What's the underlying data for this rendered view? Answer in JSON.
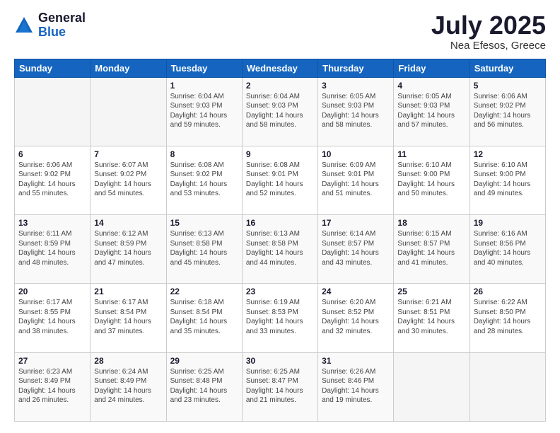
{
  "logo": {
    "general": "General",
    "blue": "Blue"
  },
  "header": {
    "month": "July 2025",
    "location": "Nea Efesos, Greece"
  },
  "weekdays": [
    "Sunday",
    "Monday",
    "Tuesday",
    "Wednesday",
    "Thursday",
    "Friday",
    "Saturday"
  ],
  "weeks": [
    [
      {
        "day": "",
        "info": ""
      },
      {
        "day": "",
        "info": ""
      },
      {
        "day": "1",
        "info": "Sunrise: 6:04 AM\nSunset: 9:03 PM\nDaylight: 14 hours and 59 minutes."
      },
      {
        "day": "2",
        "info": "Sunrise: 6:04 AM\nSunset: 9:03 PM\nDaylight: 14 hours and 58 minutes."
      },
      {
        "day": "3",
        "info": "Sunrise: 6:05 AM\nSunset: 9:03 PM\nDaylight: 14 hours and 58 minutes."
      },
      {
        "day": "4",
        "info": "Sunrise: 6:05 AM\nSunset: 9:03 PM\nDaylight: 14 hours and 57 minutes."
      },
      {
        "day": "5",
        "info": "Sunrise: 6:06 AM\nSunset: 9:02 PM\nDaylight: 14 hours and 56 minutes."
      }
    ],
    [
      {
        "day": "6",
        "info": "Sunrise: 6:06 AM\nSunset: 9:02 PM\nDaylight: 14 hours and 55 minutes."
      },
      {
        "day": "7",
        "info": "Sunrise: 6:07 AM\nSunset: 9:02 PM\nDaylight: 14 hours and 54 minutes."
      },
      {
        "day": "8",
        "info": "Sunrise: 6:08 AM\nSunset: 9:02 PM\nDaylight: 14 hours and 53 minutes."
      },
      {
        "day": "9",
        "info": "Sunrise: 6:08 AM\nSunset: 9:01 PM\nDaylight: 14 hours and 52 minutes."
      },
      {
        "day": "10",
        "info": "Sunrise: 6:09 AM\nSunset: 9:01 PM\nDaylight: 14 hours and 51 minutes."
      },
      {
        "day": "11",
        "info": "Sunrise: 6:10 AM\nSunset: 9:00 PM\nDaylight: 14 hours and 50 minutes."
      },
      {
        "day": "12",
        "info": "Sunrise: 6:10 AM\nSunset: 9:00 PM\nDaylight: 14 hours and 49 minutes."
      }
    ],
    [
      {
        "day": "13",
        "info": "Sunrise: 6:11 AM\nSunset: 8:59 PM\nDaylight: 14 hours and 48 minutes."
      },
      {
        "day": "14",
        "info": "Sunrise: 6:12 AM\nSunset: 8:59 PM\nDaylight: 14 hours and 47 minutes."
      },
      {
        "day": "15",
        "info": "Sunrise: 6:13 AM\nSunset: 8:58 PM\nDaylight: 14 hours and 45 minutes."
      },
      {
        "day": "16",
        "info": "Sunrise: 6:13 AM\nSunset: 8:58 PM\nDaylight: 14 hours and 44 minutes."
      },
      {
        "day": "17",
        "info": "Sunrise: 6:14 AM\nSunset: 8:57 PM\nDaylight: 14 hours and 43 minutes."
      },
      {
        "day": "18",
        "info": "Sunrise: 6:15 AM\nSunset: 8:57 PM\nDaylight: 14 hours and 41 minutes."
      },
      {
        "day": "19",
        "info": "Sunrise: 6:16 AM\nSunset: 8:56 PM\nDaylight: 14 hours and 40 minutes."
      }
    ],
    [
      {
        "day": "20",
        "info": "Sunrise: 6:17 AM\nSunset: 8:55 PM\nDaylight: 14 hours and 38 minutes."
      },
      {
        "day": "21",
        "info": "Sunrise: 6:17 AM\nSunset: 8:54 PM\nDaylight: 14 hours and 37 minutes."
      },
      {
        "day": "22",
        "info": "Sunrise: 6:18 AM\nSunset: 8:54 PM\nDaylight: 14 hours and 35 minutes."
      },
      {
        "day": "23",
        "info": "Sunrise: 6:19 AM\nSunset: 8:53 PM\nDaylight: 14 hours and 33 minutes."
      },
      {
        "day": "24",
        "info": "Sunrise: 6:20 AM\nSunset: 8:52 PM\nDaylight: 14 hours and 32 minutes."
      },
      {
        "day": "25",
        "info": "Sunrise: 6:21 AM\nSunset: 8:51 PM\nDaylight: 14 hours and 30 minutes."
      },
      {
        "day": "26",
        "info": "Sunrise: 6:22 AM\nSunset: 8:50 PM\nDaylight: 14 hours and 28 minutes."
      }
    ],
    [
      {
        "day": "27",
        "info": "Sunrise: 6:23 AM\nSunset: 8:49 PM\nDaylight: 14 hours and 26 minutes."
      },
      {
        "day": "28",
        "info": "Sunrise: 6:24 AM\nSunset: 8:49 PM\nDaylight: 14 hours and 24 minutes."
      },
      {
        "day": "29",
        "info": "Sunrise: 6:25 AM\nSunset: 8:48 PM\nDaylight: 14 hours and 23 minutes."
      },
      {
        "day": "30",
        "info": "Sunrise: 6:25 AM\nSunset: 8:47 PM\nDaylight: 14 hours and 21 minutes."
      },
      {
        "day": "31",
        "info": "Sunrise: 6:26 AM\nSunset: 8:46 PM\nDaylight: 14 hours and 19 minutes."
      },
      {
        "day": "",
        "info": ""
      },
      {
        "day": "",
        "info": ""
      }
    ]
  ]
}
